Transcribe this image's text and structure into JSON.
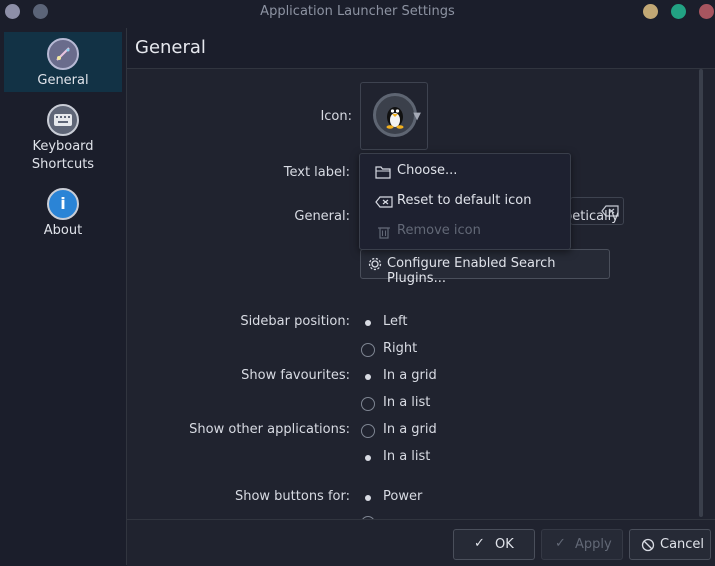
{
  "window": {
    "title": "Application Launcher Settings",
    "left_button_colors": [
      "#8d8fa8",
      "#5b6478"
    ],
    "right_button_colors": [
      "#c2a875",
      "#22a283",
      "#a8555f"
    ]
  },
  "sidebar": {
    "items": [
      {
        "label": "General",
        "icon": "general-icon",
        "active": true
      },
      {
        "label": "Keyboard Shortcuts",
        "icon": "keyboard-icon",
        "active": false
      },
      {
        "label": "About",
        "icon": "info-icon",
        "active": false
      }
    ]
  },
  "page": {
    "title": "General",
    "icon_label": "Icon:",
    "text_label_label": "Text label:",
    "general_label": "General:",
    "general_partial_text": "petically",
    "configure_plugins_label": "Configure Enabled Search Plugins...",
    "sidebar_position": {
      "label": "Sidebar position:",
      "options": [
        "Left",
        "Right"
      ],
      "selected": "Left"
    },
    "show_favourites": {
      "label": "Show favourites:",
      "options": [
        "In a grid",
        "In a list"
      ],
      "selected": "In a grid"
    },
    "show_other_apps": {
      "label": "Show other applications:",
      "options": [
        "In a grid",
        "In a list"
      ],
      "selected": "In a list"
    },
    "show_buttons_for": {
      "label": "Show buttons for:",
      "options": [
        "Power"
      ],
      "selected": "Power"
    }
  },
  "icon_menu": {
    "items": [
      {
        "label": "Choose...",
        "icon": "folder-icon",
        "enabled": true
      },
      {
        "label": "Reset to default icon",
        "icon": "clear-icon",
        "enabled": true
      },
      {
        "label": "Remove icon",
        "icon": "trash-icon",
        "enabled": false
      }
    ]
  },
  "footer": {
    "ok_label": "OK",
    "apply_label": "Apply",
    "cancel_label": "Cancel"
  },
  "colors": {
    "accent": "#123245",
    "background": "#20232f",
    "text": "#d8dbe3"
  }
}
